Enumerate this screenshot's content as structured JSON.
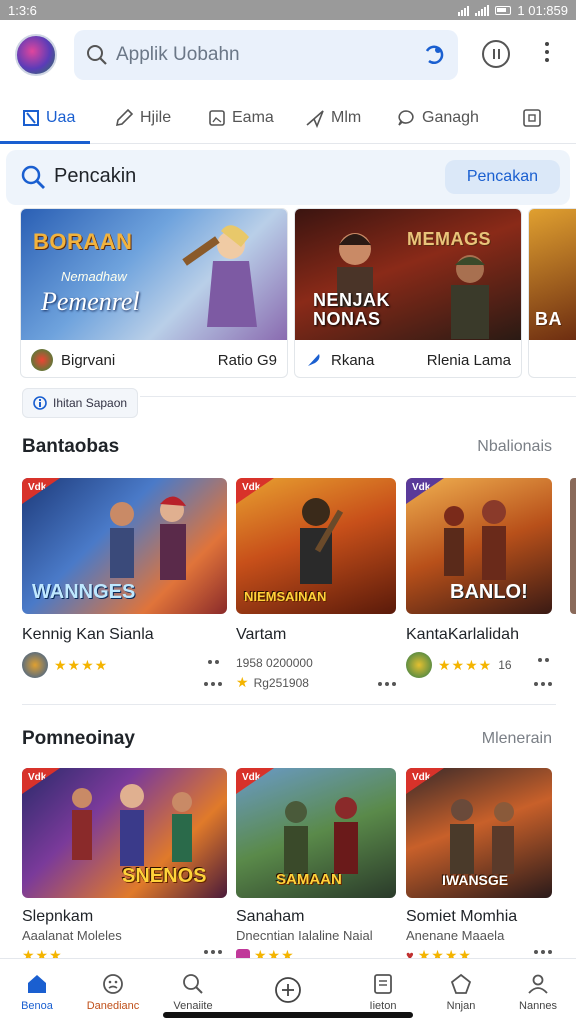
{
  "status": {
    "time": "1:3:6",
    "clock": "1 01:859"
  },
  "search": {
    "placeholder": "Applik Uobahn"
  },
  "tabs": [
    {
      "label": "Uaa",
      "icon": "app-icon"
    },
    {
      "label": "Hjile",
      "icon": "pencil-icon"
    },
    {
      "label": "Eama",
      "icon": "image-icon"
    },
    {
      "label": "Mlm",
      "icon": "send-icon"
    },
    {
      "label": "Ganagh",
      "icon": "chat-icon"
    },
    {
      "label": "",
      "icon": "square-icon"
    }
  ],
  "search_section": {
    "label": "Pencakin",
    "button": "Pencakan"
  },
  "banners": [
    {
      "title": "BORAAN",
      "subtitle": "Pemenrel",
      "small": "Nemadhaw",
      "footer_left": "Bigrvani",
      "footer_right": "Ratio G9"
    },
    {
      "title": "NENJAK\nNONAS",
      "subtitle": "MEMAGS",
      "small": "",
      "footer_left": "Rkana",
      "footer_right": "Rlenia Lama"
    },
    {
      "title": "BA",
      "subtitle": "",
      "small": "",
      "footer_left": "",
      "footer_right": ""
    }
  ],
  "chip": {
    "label": "Ihitan Sapaon"
  },
  "section1": {
    "title": "Bantaobas",
    "more": "Nbalionais"
  },
  "section1_cards": [
    {
      "tag": "Vdk",
      "logo": "WANNGES",
      "name": "Kennig Kan Sianla",
      "stars": "★★★★",
      "line1": "",
      "line2": ""
    },
    {
      "tag": "Vdk",
      "logo": "NIEMSAINAN",
      "name": "Vartam",
      "stars": "★",
      "line1": "1958 0200000",
      "line2": "Rg251908"
    },
    {
      "tag": "Vdk",
      "logo": "BANLO!",
      "name": "KantaKarlalidah",
      "stars": "★★★★",
      "line1": "16",
      "line2": ""
    }
  ],
  "section2": {
    "title": "Pomneoinay",
    "more": "Mlenerain"
  },
  "section2_cards": [
    {
      "tag": "Vdk",
      "logo": "SNENOS",
      "name": "Slepnkam",
      "sub": "Aaalanat Moleles",
      "stars": "★★★"
    },
    {
      "tag": "Vdk",
      "logo": "SAMAAN",
      "name": "Sanaham",
      "sub": "Dnecntian Ialaline Naial",
      "stars": "★★★"
    },
    {
      "tag": "Vdk",
      "logo": "IWANSGE",
      "name": "Somiet Momhia",
      "sub": "Anenane Maaela",
      "stars": "★★★★"
    }
  ],
  "bottom_nav": [
    {
      "label": "Benoa",
      "icon": "home-icon",
      "active": true
    },
    {
      "label": "Danedianc",
      "icon": "face-icon",
      "active": false
    },
    {
      "label": "Venaiite",
      "icon": "search-icon",
      "active": false
    },
    {
      "label": "",
      "icon": "add-circle-icon",
      "active": false
    },
    {
      "label": "Iieton",
      "icon": "document-icon",
      "active": false
    },
    {
      "label": "Nnjan",
      "icon": "pentagon-icon",
      "active": false
    },
    {
      "label": "Nannes",
      "icon": "person-icon",
      "active": false
    }
  ],
  "colors": {
    "accent": "#1a5fd0",
    "search_bg": "#eaf1fb",
    "tag_red": "#d8322a",
    "star": "#f4b400"
  }
}
